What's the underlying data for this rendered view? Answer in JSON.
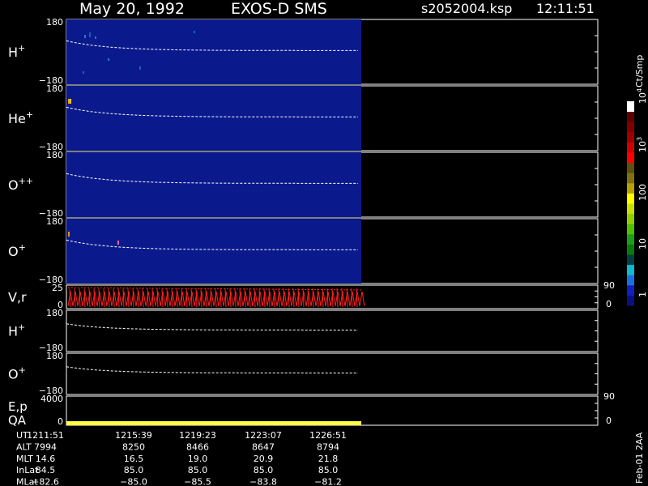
{
  "header": {
    "date": "May 20, 1992",
    "instrument": "EXOS-D SMS",
    "file": "s2052004.ksp",
    "time": "12:11:51"
  },
  "colorbar": {
    "label": "Ct/Smp",
    "ticks": [
      "1",
      "10",
      "100",
      "10",
      "10"
    ],
    "tick_exponents": [
      "",
      "",
      "",
      "3",
      "4"
    ],
    "colors": [
      "#0b1080",
      "#1020c0",
      "#1870e0",
      "#10b8d0",
      "#004040",
      "#0a7a0a",
      "#18a018",
      "#50c000",
      "#90d000",
      "#c8e000",
      "#ffff00",
      "#b8a000",
      "#807010",
      "#605010",
      "#ff0000",
      "#d00000",
      "#a00000",
      "#800000",
      "#600000",
      "#ffffff"
    ]
  },
  "footer_label": "Feb-01 2AA",
  "panels": [
    {
      "label": "H",
      "sup": "+",
      "y_top": "180",
      "y_bottom": "−180"
    },
    {
      "label": "He",
      "sup": "+",
      "y_top": "180",
      "y_bottom": "−180"
    },
    {
      "label": "O",
      "sup": "++",
      "y_top": "180",
      "y_bottom": "−180"
    },
    {
      "label": "O",
      "sup": "+",
      "y_top": "180",
      "y_bottom": "−180"
    },
    {
      "label": "V,r",
      "sup": "",
      "y_top": "25",
      "y_bottom": "0",
      "right_top": "90",
      "right_bottom": "0"
    },
    {
      "label": "H",
      "sup": "+",
      "y_top": "180",
      "y_bottom": "−180"
    },
    {
      "label": "O",
      "sup": "+",
      "y_top": "180",
      "y_bottom": "−180"
    },
    {
      "label": "E,p",
      "label2": "QA",
      "sup": "",
      "y_top": "4000",
      "y_bottom": "0",
      "right_top": "90",
      "right_bottom": "0"
    }
  ],
  "table": {
    "rows": [
      {
        "label": "UT",
        "values": [
          "1211:51",
          "1215:39",
          "1219:23",
          "1223:07",
          "1226:51"
        ]
      },
      {
        "label": "ALT",
        "values": [
          "7994",
          "8250",
          "8466",
          "8647",
          "8794"
        ]
      },
      {
        "label": "MLT",
        "values": [
          "14.6",
          "16.5",
          "19.0",
          "20.9",
          "21.8"
        ]
      },
      {
        "label": "InLat",
        "values": [
          "84.5",
          "85.0",
          "85.0",
          "85.0",
          "85.0"
        ]
      },
      {
        "label": "MLat",
        "values": [
          "−82.6",
          "−85.0",
          "−85.5",
          "−83.8",
          "−81.2"
        ]
      }
    ]
  },
  "chart_data": {
    "type": "heatmap",
    "x_ticks": [
      "1211:51",
      "1215:39",
      "1219:23",
      "1223:07",
      "1226:51"
    ],
    "colors": {
      "background": "#000000",
      "spectrogram_fill": "#0a1a8c",
      "trace": "#ffffff",
      "velocity": "#ff2020",
      "qa": "#ffff40"
    }
  }
}
